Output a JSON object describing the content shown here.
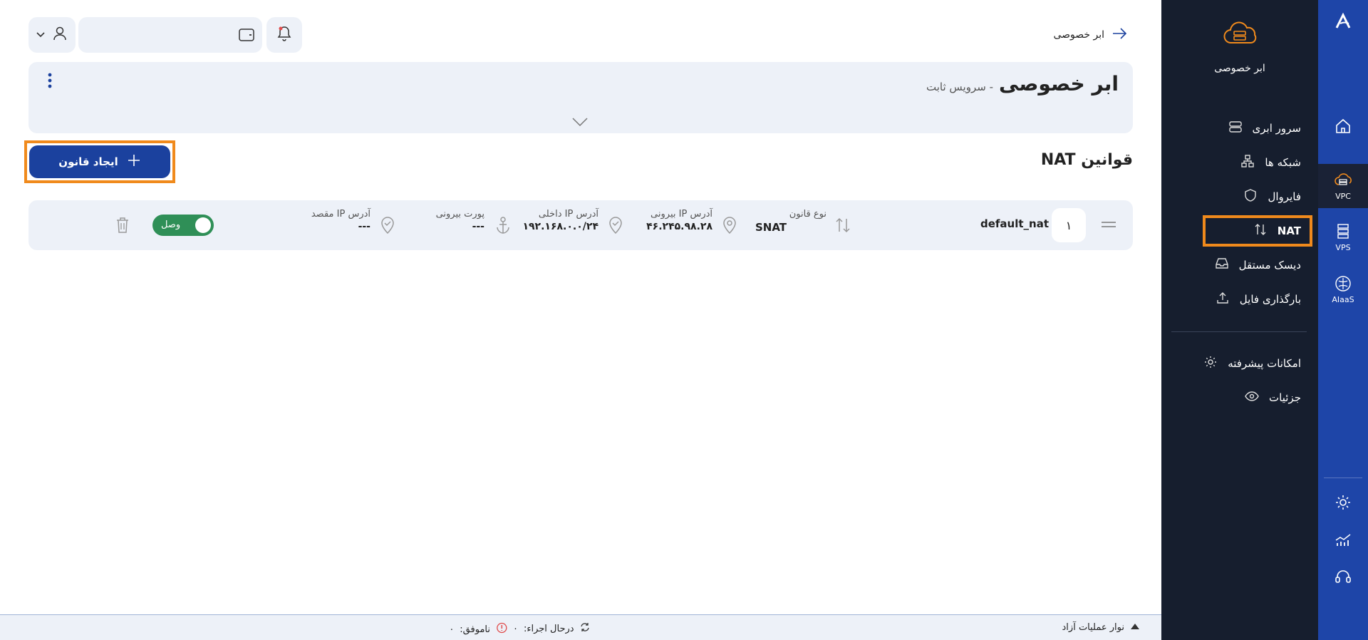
{
  "header": {
    "back_label": "ابر خصوصی",
    "service_title": "ابر خصوصی",
    "service_subtitle": "- سرویس ثابت"
  },
  "section": {
    "title": "قوانین NAT",
    "create_button": "ایجاد قانون"
  },
  "nat_row": {
    "index": "۱",
    "name": "default_nat",
    "rule_type_label": "نوع قانون",
    "rule_type_value": "SNAT",
    "external_ip_label": "آدرس IP بیرونی",
    "external_ip_value": "۴۶.۲۴۵.۹۸.۲۸",
    "internal_ip_label": "آدرس IP داخلی",
    "internal_ip_value": "۱۹۲.۱۶۸.۰.۰/۲۴",
    "external_port_label": "پورت بیرونی",
    "external_port_value": "---",
    "destination_ip_label": "آدرس IP مقصد",
    "destination_ip_value": "---",
    "status_label": "وصل"
  },
  "sidebar": {
    "service_name": "ابر خصوصی",
    "items": [
      {
        "label": "سرور ابری",
        "icon": "server-icon"
      },
      {
        "label": "شبکه ها",
        "icon": "network-icon"
      },
      {
        "label": "فایروال",
        "icon": "shield-icon"
      },
      {
        "label": "NAT",
        "icon": "swap-icon"
      },
      {
        "label": "دیسک مستقل",
        "icon": "disk-icon"
      },
      {
        "label": "بارگذاری فایل",
        "icon": "upload-icon"
      }
    ],
    "extra_items": [
      {
        "label": "امکانات پیشرفته",
        "icon": "gear-icon"
      },
      {
        "label": "جزئیات",
        "icon": "eye-icon"
      }
    ]
  },
  "rail": {
    "items": [
      {
        "label": "",
        "icon": "home-icon"
      },
      {
        "label": "VPC",
        "icon": "vpc-icon"
      },
      {
        "label": "VPS",
        "icon": "vps-icon"
      },
      {
        "label": "AIaaS",
        "icon": "ai-icon"
      }
    ]
  },
  "footer": {
    "ops_bar_label": "نوار عملیات آزاد",
    "running_label": "درحال اجراء:",
    "running_count": "۰",
    "failed_label": "ناموفق:",
    "failed_count": "۰"
  },
  "colors": {
    "primary": "#1b419e",
    "rail": "#1e45a8",
    "sidebar": "#161e2e",
    "highlight": "#f08a1c",
    "success": "#2f8f57",
    "card": "#edf1f8"
  }
}
